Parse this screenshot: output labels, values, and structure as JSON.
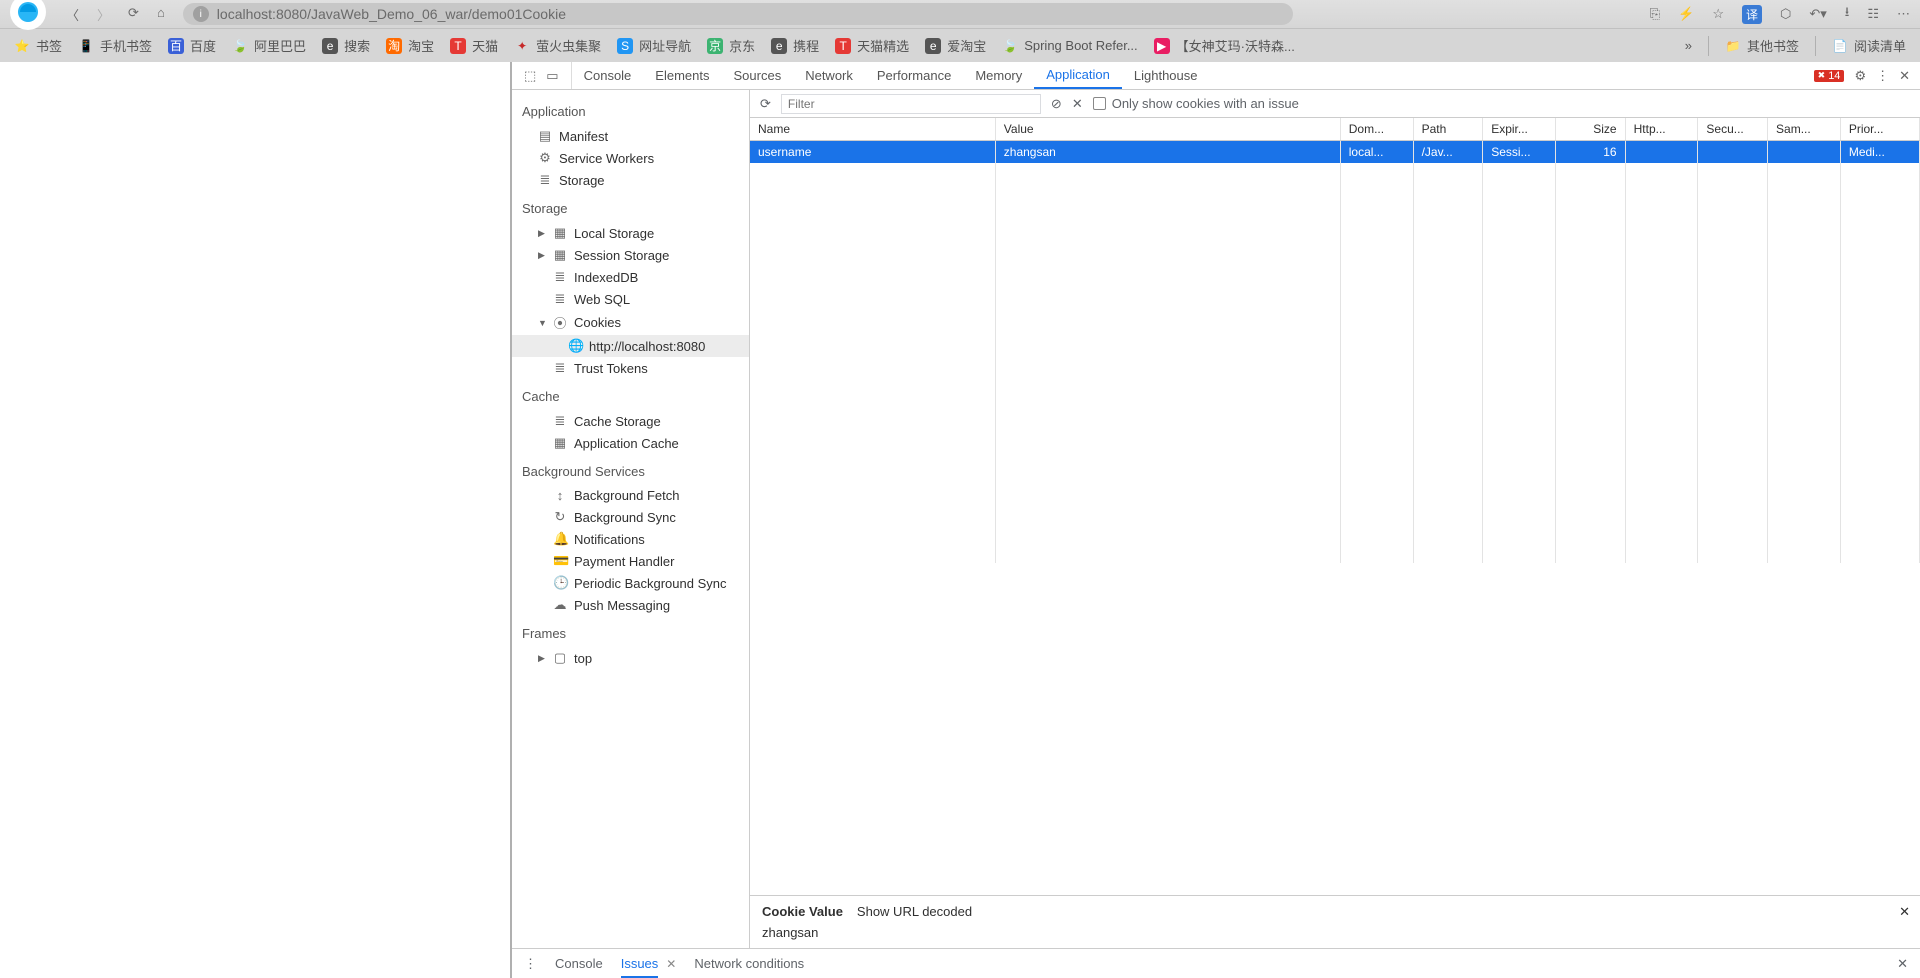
{
  "browser": {
    "url": "localhost:8080/JavaWeb_Demo_06_war/demo01Cookie",
    "translate_label": "译"
  },
  "bookmarks": {
    "items": [
      {
        "icon": "⭐",
        "color": "#f5a623",
        "label": "书签"
      },
      {
        "icon": "📱",
        "color": "#5b9bd5",
        "label": "手机书签"
      },
      {
        "icon": "百",
        "color": "#3a60d7",
        "bg": "#3a60d7",
        "fg": "#fff",
        "label": "百度"
      },
      {
        "icon": "🍃",
        "color": "#7bbf3a",
        "label": "阿里巴巴"
      },
      {
        "icon": "e",
        "color": "#fff",
        "bg": "#555",
        "label": "搜索"
      },
      {
        "icon": "淘",
        "color": "#fff",
        "bg": "#ff6a00",
        "label": "淘宝"
      },
      {
        "icon": "T",
        "color": "#fff",
        "bg": "#e53935",
        "label": "天猫"
      },
      {
        "icon": "✦",
        "color": "#c62828",
        "label": "萤火虫集聚"
      },
      {
        "icon": "S",
        "color": "#fff",
        "bg": "#2196f3",
        "label": "网址导航"
      },
      {
        "icon": "京",
        "color": "#fff",
        "bg": "#3cb371",
        "label": "京东"
      },
      {
        "icon": "e",
        "color": "#fff",
        "bg": "#555",
        "label": "携程"
      },
      {
        "icon": "T",
        "color": "#fff",
        "bg": "#e53935",
        "label": "天猫精选"
      },
      {
        "icon": "e",
        "color": "#fff",
        "bg": "#555",
        "label": "爱淘宝"
      },
      {
        "icon": "🍃",
        "color": "#6aaa3c",
        "label": "Spring Boot Refer..."
      },
      {
        "icon": "▶",
        "color": "#fff",
        "bg": "#e91e63",
        "label": "【女神艾玛·沃特森..."
      }
    ],
    "overflow": "»",
    "other_bookmarks": "其他书签",
    "reading_list": "阅读清单"
  },
  "devtools": {
    "tabs": [
      "Console",
      "Elements",
      "Sources",
      "Network",
      "Performance",
      "Memory",
      "Application",
      "Lighthouse"
    ],
    "active_tab": "Application",
    "error_count": "14"
  },
  "app_panel": {
    "sections": {
      "application": {
        "title": "Application",
        "items": [
          "Manifest",
          "Service Workers",
          "Storage"
        ]
      },
      "storage": {
        "title": "Storage",
        "items": [
          "Local Storage",
          "Session Storage",
          "IndexedDB",
          "Web SQL",
          "Cookies",
          "Trust Tokens"
        ],
        "cookie_origin": "http://localhost:8080"
      },
      "cache": {
        "title": "Cache",
        "items": [
          "Cache Storage",
          "Application Cache"
        ]
      },
      "bg": {
        "title": "Background Services",
        "items": [
          "Background Fetch",
          "Background Sync",
          "Notifications",
          "Payment Handler",
          "Periodic Background Sync",
          "Push Messaging"
        ]
      },
      "frames": {
        "title": "Frames",
        "items": [
          "top"
        ]
      }
    }
  },
  "cookies": {
    "filter_placeholder": "Filter",
    "only_issue_label": "Only show cookies with an issue",
    "columns": [
      "Name",
      "Value",
      "Dom...",
      "Path",
      "Expir...",
      "Size",
      "Http...",
      "Secu...",
      "Sam...",
      "Prior..."
    ],
    "rows": [
      {
        "name": "username",
        "value": "zhangsan",
        "domain": "local...",
        "path": "/Jav...",
        "expires": "Sessi...",
        "size": "16",
        "http": "",
        "secure": "",
        "same": "",
        "priority": "Medi..."
      }
    ],
    "detail_title": "Cookie Value",
    "url_decoded_label": "Show URL decoded",
    "detail_value": "zhangsan"
  },
  "drawer": {
    "tabs": [
      "Console",
      "Issues",
      "Network conditions"
    ],
    "active": "Issues"
  }
}
